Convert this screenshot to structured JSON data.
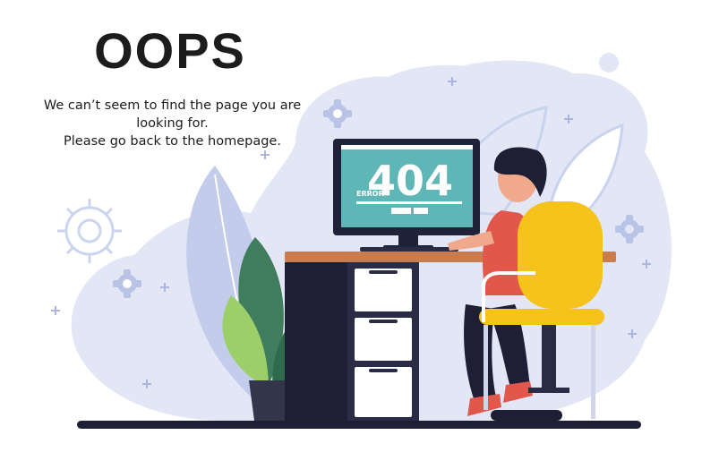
{
  "heading": "OOPS",
  "message": {
    "line1": "We can’t seem to find the page you are",
    "line2": "looking for.",
    "line3": "Please go back to the homepage."
  },
  "monitor": {
    "code": "404",
    "label": "ERROR"
  },
  "colors": {
    "background": "#ffffff",
    "blob": "#e3e7f5",
    "screen": "#5fb6b6",
    "chair": "#f6c21c",
    "shirt": "#e2574c",
    "desk": "#c97c4e",
    "plant": "#3f7d5c"
  }
}
